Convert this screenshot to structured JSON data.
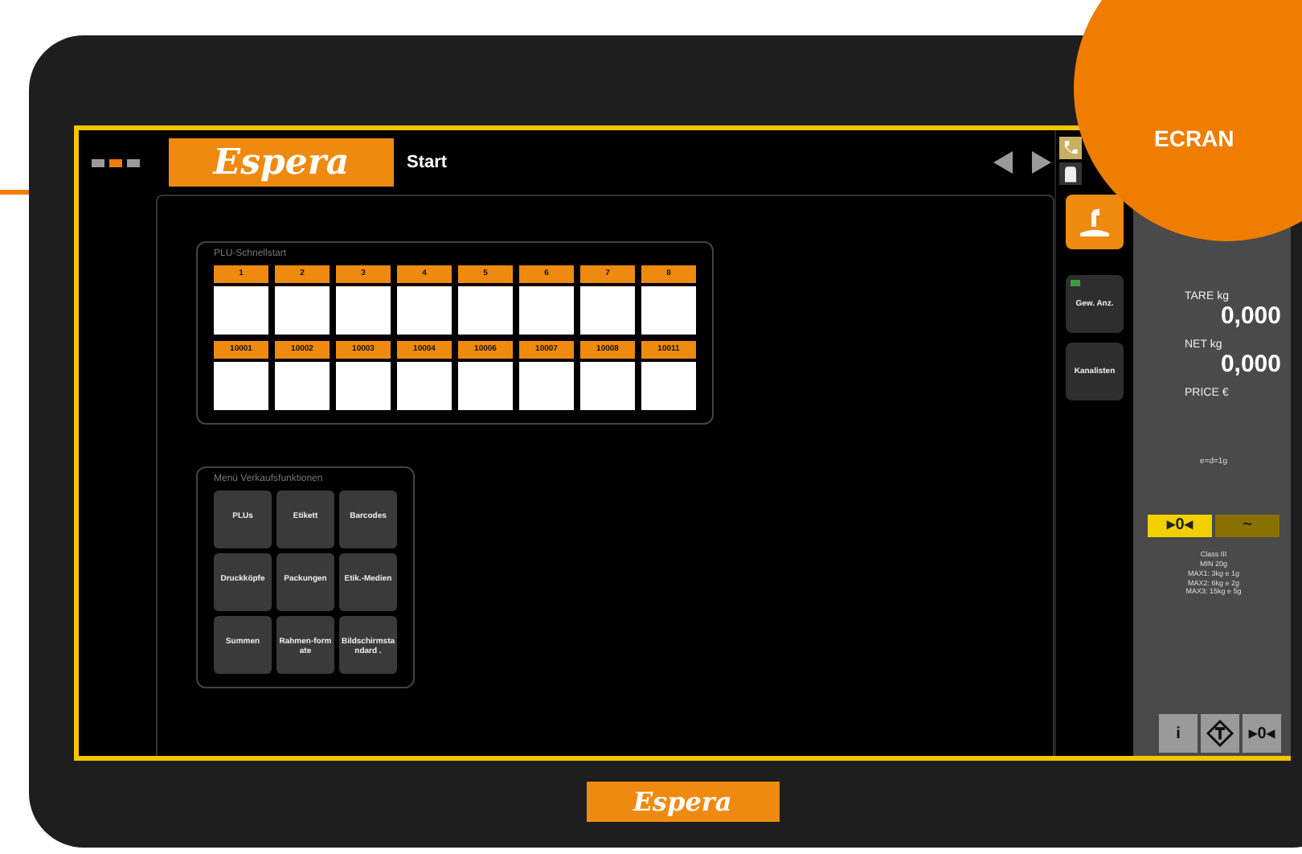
{
  "header": {
    "pages": [
      {
        "selected": false
      },
      {
        "selected": true
      },
      {
        "selected": false
      }
    ],
    "logo": "Espera",
    "title": "Start"
  },
  "plu_panel": {
    "title": "PLU-Schnellstart",
    "rows": [
      [
        {
          "label": "1"
        },
        {
          "label": "2"
        },
        {
          "label": "3"
        },
        {
          "label": "4"
        },
        {
          "label": "5"
        },
        {
          "label": "6"
        },
        {
          "label": "7"
        },
        {
          "label": "8"
        }
      ],
      [
        {
          "label": "10001"
        },
        {
          "label": "10002"
        },
        {
          "label": "10003"
        },
        {
          "label": "10004"
        },
        {
          "label": "10006"
        },
        {
          "label": "10007"
        },
        {
          "label": "10008"
        },
        {
          "label": "10011"
        }
      ]
    ]
  },
  "menu_panel": {
    "title": "Menü Verkaufsfunktionen",
    "buttons": [
      "PLUs",
      "Etikett",
      "Barcodes",
      "Druckköpfe",
      "Packungen",
      "Etik.-Medien",
      "Summen",
      "Rahmen-formate",
      "Bildschirmstandard ."
    ]
  },
  "side_buttons": [
    {
      "label": "Gew. Anz.",
      "indicator": true
    },
    {
      "label": "Kanalisten",
      "indicator": false
    }
  ],
  "scale": {
    "tare_label": "TARE kg",
    "tare": "0,000",
    "net_label": "NET kg",
    "net": "0,000",
    "price_label": "PRICE €",
    "division": "e=d=1g",
    "indicators": [
      {
        "label": "▸0◂",
        "on": true
      },
      {
        "label": "~",
        "on": false
      }
    ],
    "specs": [
      "Class III",
      "MIN 20g",
      "MAX1: 3kg e 1g",
      "MAX2: 6kg e 2g",
      "MAX3: 15kg e 5g"
    ],
    "buttons": [
      {
        "kind": "text",
        "label": "i"
      },
      {
        "kind": "tare"
      },
      {
        "kind": "text",
        "label": "▸0◂"
      }
    ]
  },
  "footer": {
    "logo": "Espera"
  },
  "badge": "ECRAN"
}
